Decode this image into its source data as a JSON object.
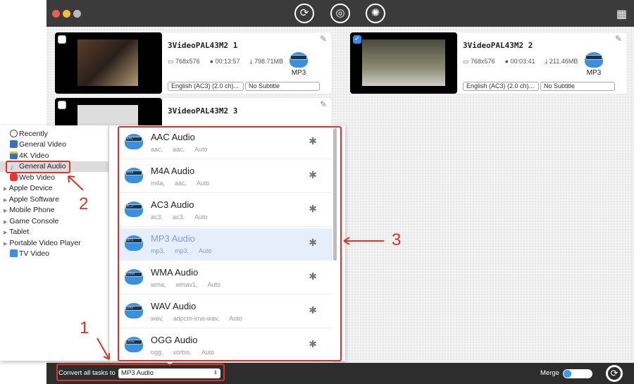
{
  "window": {
    "toolbar_icons": [
      "convert-icon",
      "rip-icon",
      "film-reel-icon"
    ],
    "right_icon": "video-edit-icon"
  },
  "videos": [
    {
      "title": "3VideoPAL43M2 1",
      "resolution": "768x576",
      "duration": "00:13:57",
      "size": "798.71MB",
      "format": "MP3",
      "audio": "English (AC3) (2.0 ch)...",
      "subtitle": "No Subtitle",
      "checked": false
    },
    {
      "title": "3VideoPAL43M2 2",
      "resolution": "768x576",
      "duration": "00:03:41",
      "size": "211.46MB",
      "format": "MP3",
      "audio": "English (AC3) (2.0 ch)...",
      "subtitle": "No Subtitle",
      "checked": true
    },
    {
      "title": "3VideoPAL43M2 3",
      "checked": false
    }
  ],
  "categories": [
    {
      "label": "Recently",
      "icon": "clock-icon"
    },
    {
      "label": "General Video",
      "icon": "video-icon"
    },
    {
      "label": "4K Video",
      "icon": "4k-icon"
    },
    {
      "label": "General Audio",
      "icon": "music-note-icon",
      "selected": true
    },
    {
      "label": "Web Video",
      "icon": "youtube-icon"
    },
    {
      "label": "Apple Device",
      "expandable": true
    },
    {
      "label": "Apple Software",
      "expandable": true
    },
    {
      "label": "Mobile Phone",
      "expandable": true
    },
    {
      "label": "Game Console",
      "expandable": true
    },
    {
      "label": "Tablet",
      "expandable": true
    },
    {
      "label": "Portable Video Player",
      "expandable": true
    },
    {
      "label": "TV Video",
      "icon": "tv-icon"
    }
  ],
  "formats": [
    {
      "name": "AAC Audio",
      "badge": "AAC",
      "ext": "aac,",
      "codec": "aac,",
      "bitrate": "Auto"
    },
    {
      "name": "M4A Audio",
      "badge": "M4A",
      "ext": "m4a,",
      "codec": "aac,",
      "bitrate": "Auto"
    },
    {
      "name": "AC3 Audio",
      "badge": "AC3",
      "ext": "ac3,",
      "codec": "ac3,",
      "bitrate": "Auto"
    },
    {
      "name": "MP3 Audio",
      "badge": "MP3",
      "ext": "mp3,",
      "codec": "mp3,",
      "bitrate": "Auto",
      "selected": true
    },
    {
      "name": "WMA Audio",
      "badge": "WMA",
      "ext": "wma,",
      "codec": "wmav1,",
      "bitrate": "Auto"
    },
    {
      "name": "WAV Audio",
      "badge": "WAV",
      "ext": "wav,",
      "codec": "adpcm-ima-wav,",
      "bitrate": "Auto"
    },
    {
      "name": "OGG Audio",
      "badge": "OGG",
      "ext": "ogg,",
      "codec": "vorbis,",
      "bitrate": "Auto"
    }
  ],
  "bottom": {
    "convert_label": "Convert all tasks to",
    "convert_value": "MP3 Audio",
    "merge_label": "Merge",
    "merge_on": false
  },
  "annotations": [
    "1",
    "2",
    "3"
  ],
  "colors": {
    "highlight": "#d9342b",
    "accent": "#3b87f0",
    "titlebar": "#3b3b3b"
  }
}
